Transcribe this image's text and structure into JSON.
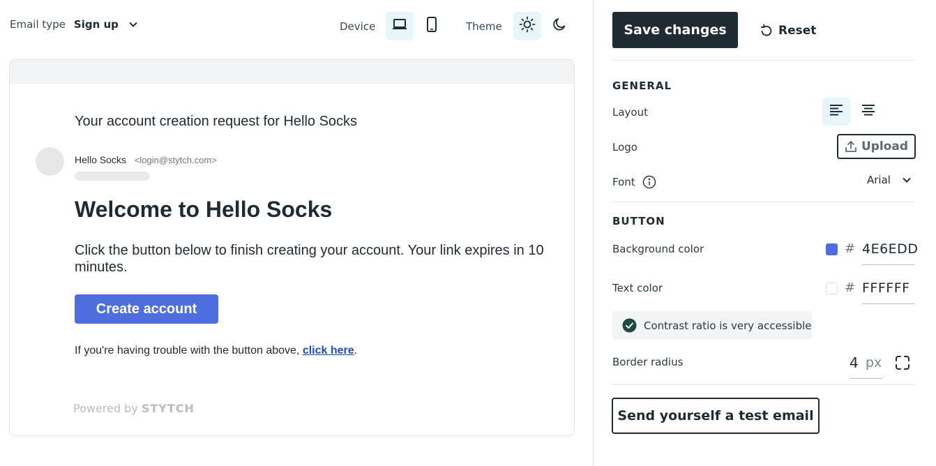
{
  "toolbar": {
    "email_type_label": "Email type",
    "email_type_value": "Sign up",
    "device_label": "Device",
    "theme_label": "Theme"
  },
  "preview": {
    "subject": "Your account creation request for Hello Socks",
    "sender_name": "Hello Socks",
    "sender_email": "<login@stytch.com>",
    "heading": "Welcome to Hello Socks",
    "body": "Click the button below to finish creating your account. Your link expires in 10 minutes.",
    "cta_label": "Create account",
    "trouble_text": "If you're having trouble with the button above,",
    "trouble_link": "click here",
    "trouble_end": ".",
    "powered_by": "Powered by",
    "powered_brand": "STYTCH"
  },
  "panel": {
    "save_label": "Save changes",
    "reset_label": "Reset",
    "general_section": "GENERAL",
    "layout_label": "Layout",
    "logo_label": "Logo",
    "upload_label": "Upload",
    "font_label": "Font",
    "font_value": "Arial",
    "button_section": "BUTTON",
    "bg_color_label": "Background color",
    "bg_color_value": "4E6EDD",
    "text_color_label": "Text color",
    "text_color_value": "FFFFFF",
    "hash": "#",
    "contrast_text": "Contrast ratio is very accessible",
    "border_radius_label": "Border radius",
    "border_radius_value": "4",
    "border_radius_unit": "px",
    "test_email_label": "Send yourself a test email"
  },
  "icons": {
    "email_type_chevron": "chevron-down-icon",
    "device_desktop": "laptop-icon",
    "device_mobile": "phone-icon",
    "theme_light": "sun-icon",
    "theme_dark": "moon-icon",
    "reset": "reset-icon",
    "layout_left": "align-left-icon",
    "layout_center": "align-center-icon",
    "upload": "upload-icon",
    "font_info": "info-icon",
    "font_chevron": "chevron-down-icon",
    "contrast_check": "check-circle-icon",
    "border_radius": "corner-radius-icon"
  },
  "colors": {
    "primary_dark": "#1e2b33",
    "accent_light": "#e7f6fb",
    "button_background": "#4E6EDD",
    "button_text": "#FFFFFF",
    "link": "#1f4bb8",
    "success": "#1e4a44"
  }
}
